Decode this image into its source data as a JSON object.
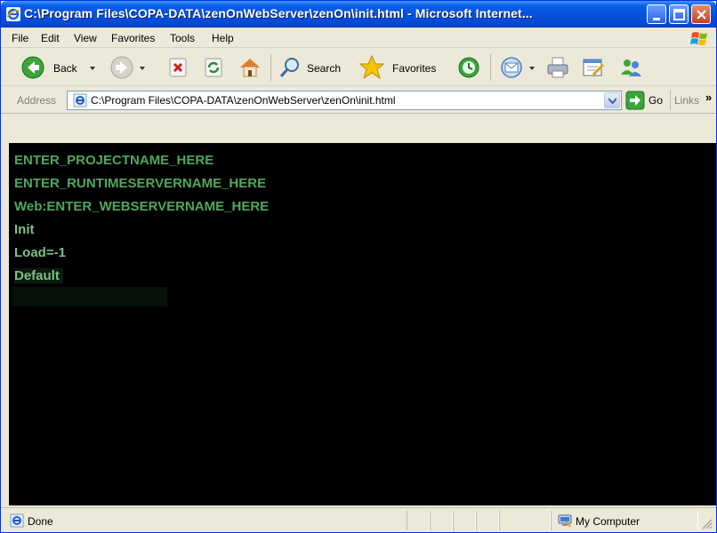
{
  "window": {
    "title": "C:\\Program Files\\COPA-DATA\\zenOnWebServer\\zenOn\\init.html - Microsoft Internet...",
    "title_icon": "ie-icon",
    "controls": [
      "minimize-icon",
      "maximize-icon",
      "close-icon"
    ]
  },
  "menu": {
    "items": [
      "File",
      "Edit",
      "View",
      "Favorites",
      "Tools",
      "Help"
    ]
  },
  "toolbar": {
    "back_label": "Back",
    "search_label": "Search",
    "favorites_label": "Favorites"
  },
  "address": {
    "label": "Address",
    "value": "C:\\Program Files\\COPA-DATA\\zenOnWebServer\\zenOn\\init.html",
    "go_label": "Go",
    "links_label": "Links"
  },
  "content": {
    "lines": [
      "ENTER_PROJECTNAME_HERE",
      "ENTER_RUNTIMESERVERNAME_HERE",
      "Web:ENTER_WEBSERVERNAME_HERE",
      "Init",
      "Load=-1",
      "Default"
    ],
    "colors": {
      "background": "#000000",
      "text_primary": "#4fa85c",
      "text_secondary": "#7fbf88"
    }
  },
  "status": {
    "text": "Done",
    "zone": "My Computer"
  }
}
